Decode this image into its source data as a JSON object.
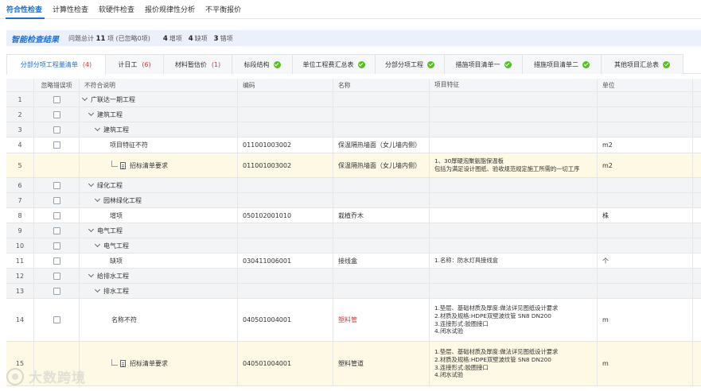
{
  "top_tabs": [
    "符合性检查",
    "计算性检查",
    "软硬件检查",
    "报价规律性分析",
    "不平衡报价"
  ],
  "summary": {
    "title": "智能检查结果",
    "prefix": "问题总计",
    "total": "11",
    "unit": "项",
    "ignored": "(已忽略0项)",
    "extra_num": "4",
    "extra_label": "增项",
    "missing_num": "4",
    "missing_label": "缺项",
    "wrong_num": "3",
    "wrong_label": "错项"
  },
  "sub_tabs": [
    {
      "label": "分部分项工程量清单",
      "count": "(4)",
      "ok": false
    },
    {
      "label": "计日工",
      "count": "(6)",
      "ok": false
    },
    {
      "label": "材料暂估价",
      "count": "(1)",
      "ok": false
    },
    {
      "label": "标段结构",
      "count": "",
      "ok": true
    },
    {
      "label": "单位工程费汇总表",
      "count": "",
      "ok": true
    },
    {
      "label": "分部分项工程",
      "count": "",
      "ok": true
    },
    {
      "label": "措施项目清单一",
      "count": "",
      "ok": true
    },
    {
      "label": "措施项目清单二",
      "count": "",
      "ok": true
    },
    {
      "label": "其他项目汇总表",
      "count": "",
      "ok": true
    }
  ],
  "columns": [
    "",
    "忽略错误项",
    "不符合说明",
    "编码",
    "名称",
    "项目特征",
    "单位"
  ],
  "rows": [
    {
      "no": "1",
      "desc": "广联达一期工程",
      "code": "",
      "name": "",
      "feat": [],
      "unit": ""
    },
    {
      "no": "2",
      "desc": "建筑工程",
      "code": "",
      "name": "",
      "feat": [],
      "unit": ""
    },
    {
      "no": "3",
      "desc": "建筑工程",
      "code": "",
      "name": "",
      "feat": [],
      "unit": ""
    },
    {
      "no": "4",
      "desc": "项目特征不符",
      "code": "011001003002",
      "name": "保温隔热墙面（女儿墙内侧）",
      "feat": [],
      "unit": "m2"
    },
    {
      "no": "5",
      "desc": "招标清单要求",
      "code": "011001003002",
      "name": "保温隔热墙面（女儿墙内侧）",
      "feat": [
        "1、30厚硬泡聚氨脂保温板",
        "包括为满足设计图纸、验收规范规定施工所需的一切工序"
      ],
      "unit": "m2"
    },
    {
      "no": "6",
      "desc": "绿化工程",
      "code": "",
      "name": "",
      "feat": [],
      "unit": ""
    },
    {
      "no": "7",
      "desc": "园林绿化工程",
      "code": "",
      "name": "",
      "feat": [],
      "unit": ""
    },
    {
      "no": "8",
      "desc": "增项",
      "code": "050102001010",
      "name": "栽植乔木",
      "feat": [],
      "unit": "株"
    },
    {
      "no": "9",
      "desc": "电气工程",
      "code": "",
      "name": "",
      "feat": [],
      "unit": ""
    },
    {
      "no": "10",
      "desc": "电气工程",
      "code": "",
      "name": "",
      "feat": [],
      "unit": ""
    },
    {
      "no": "11",
      "desc": "缺项",
      "code": "030411006001",
      "name": "接线盒",
      "feat": [
        "1.名称：防水灯具接线盒"
      ],
      "unit": "个"
    },
    {
      "no": "12",
      "desc": "给排水工程",
      "code": "",
      "name": "",
      "feat": [],
      "unit": ""
    },
    {
      "no": "13",
      "desc": "排水工程",
      "code": "",
      "name": "",
      "feat": [],
      "unit": ""
    },
    {
      "no": "14",
      "desc": "名称不符",
      "code": "040501004001",
      "name": "塑料管",
      "feat": [
        "1.垫层、基础材质及厚度:做法详见图纸设计要求",
        "2.材质及规格:HDPE双壁波纹管 SN8 DN200",
        "3.连接形式:胶圈接口",
        "4.闭水试验"
      ],
      "unit": "m"
    },
    {
      "no": "15",
      "desc": "招标清单要求",
      "code": "040501004001",
      "name": "塑料管道",
      "feat": [
        "1.垫层、基础材质及厚度:做法详见图纸设计要求",
        "2.材质及规格:HDPE双壁波纹管 SN8 DN200",
        "3.连接形式:胶圈接口",
        "4.闭水试验"
      ],
      "unit": "m"
    }
  ],
  "watermark": "大数跨境"
}
